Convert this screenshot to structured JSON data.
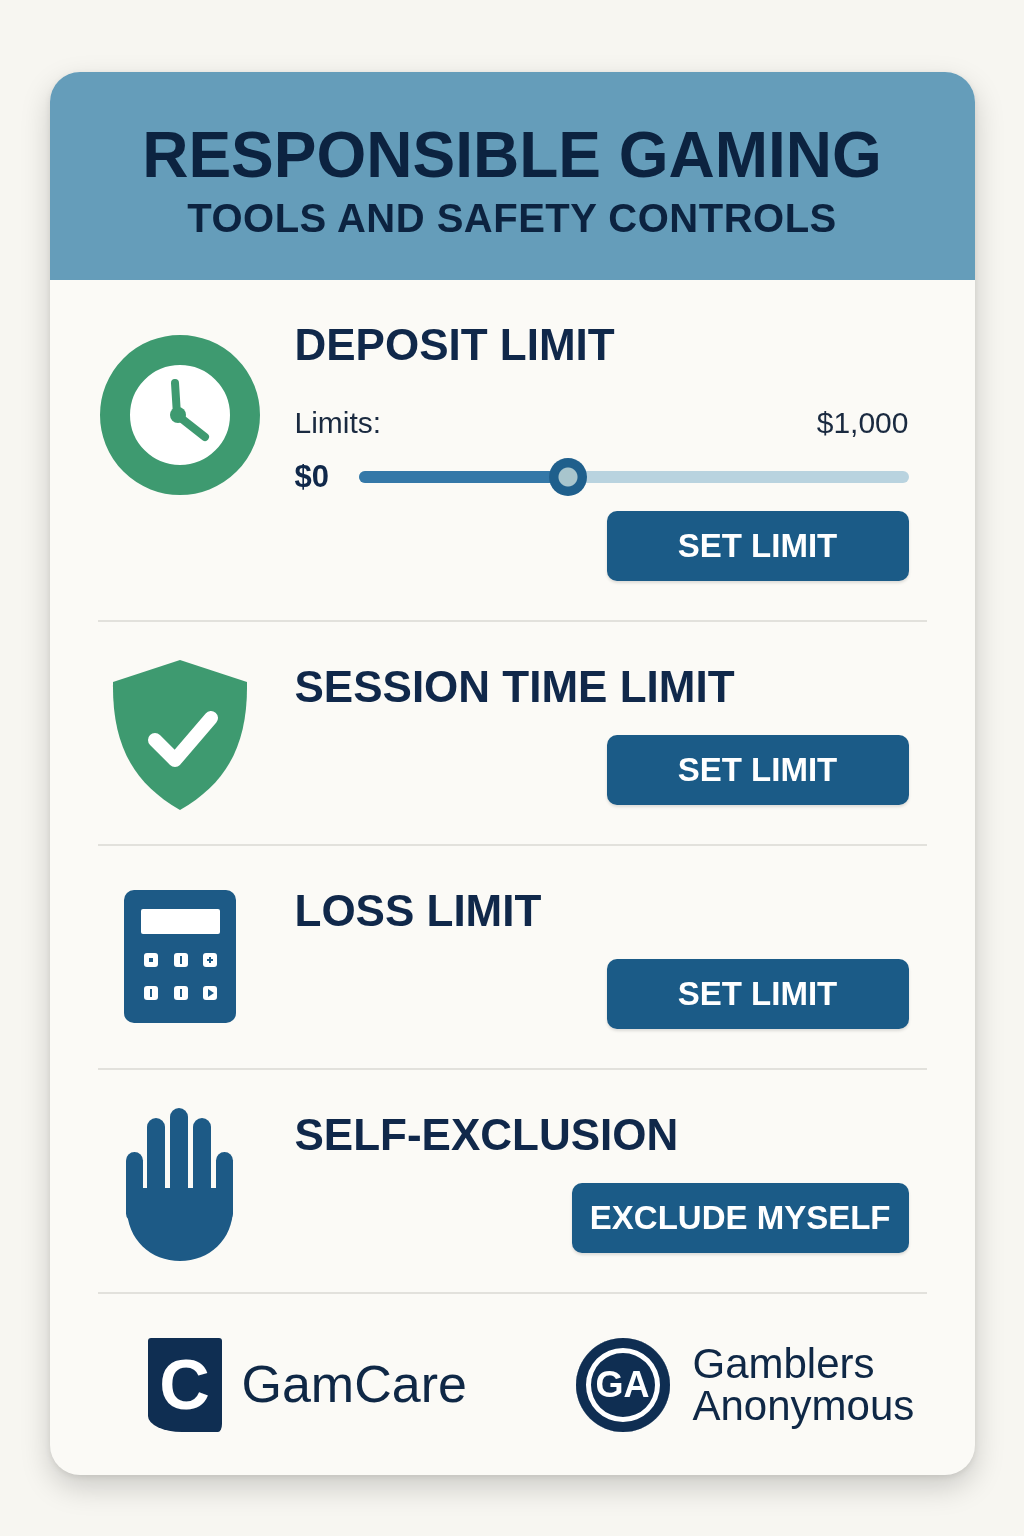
{
  "header": {
    "title": "RESPONSIBLE GAMING",
    "subtitle": "TOOLS AND SAFETY CONTROLS"
  },
  "tools": [
    {
      "title": "DEPOSIT LIMIT",
      "slider": {
        "label": "Limits:",
        "min": "$0",
        "max": "$1,000",
        "level": 0.38
      },
      "button": "SET LIMIT"
    },
    {
      "title": "SESSION TIME LIMIT",
      "button": "SET LIMIT"
    },
    {
      "title": "LOSS LIMIT",
      "button": "SET LIMIT"
    },
    {
      "title": "SELF-EXCLUSION",
      "button": "EXCLUDE MYSELF"
    }
  ],
  "partners": [
    {
      "kind": "shield",
      "mark": "C",
      "name": "GamCare"
    },
    {
      "kind": "circle",
      "mark": "GA",
      "name": "Gamblers Anonymous"
    }
  ]
}
